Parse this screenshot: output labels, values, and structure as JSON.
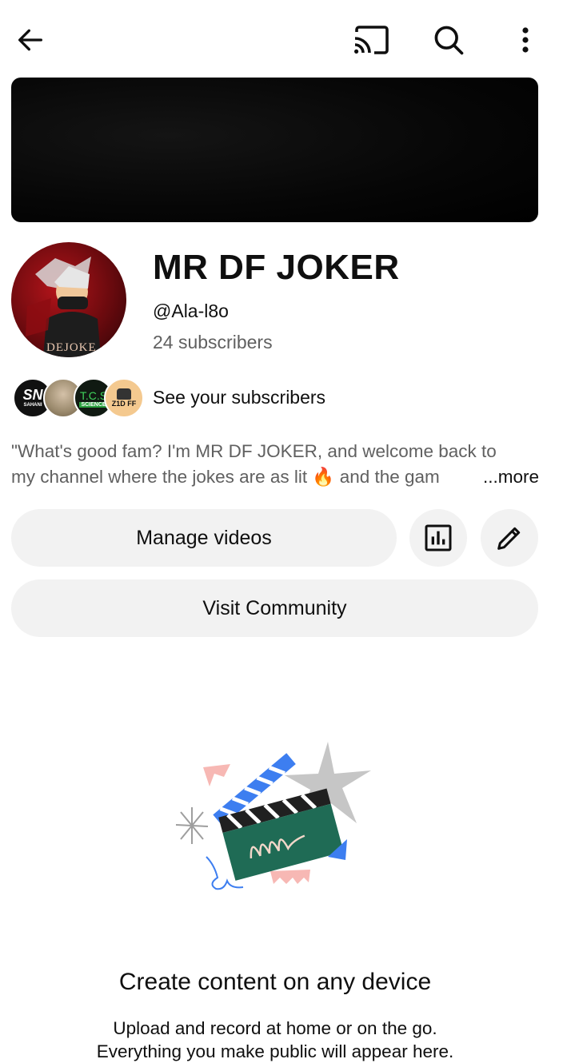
{
  "topbar": {
    "back_icon": "arrow-left-icon",
    "cast_icon": "cast-icon",
    "search_icon": "search-icon",
    "more_icon": "more-vertical-icon"
  },
  "channel": {
    "name": "MR DF JOKER",
    "handle": "@Ala-l8o",
    "subscribers": "24 subscribers",
    "avatar_text": "DEJOKE"
  },
  "subscriber_preview": {
    "label": "See your subscribers",
    "avatars": [
      "SN",
      "",
      "T.C.S",
      "Z1D FF"
    ],
    "avatar_sublabels": [
      "SAHANI",
      "",
      "SCIENCE",
      ""
    ]
  },
  "description": {
    "line1": "\"What's good fam? I'm MR DF JOKER, and welcome back to",
    "line2": "my channel where the jokes are as lit 🔥 and the gam",
    "more": "...more"
  },
  "actions": {
    "manage_videos": "Manage videos",
    "analytics_icon": "analytics-icon",
    "edit_icon": "pencil-icon",
    "visit_community": "Visit Community"
  },
  "empty_state": {
    "illustration": "clapperboard-illustration",
    "title": "Create content on any device",
    "line1": "Upload and record at home or on the go.",
    "line2": "Everything you make public will appear here."
  },
  "colors": {
    "accent_blue": "#3d7ef0",
    "clapper_green": "#1f6b55",
    "secondary_text": "#606060",
    "button_bg": "#f2f2f2"
  }
}
